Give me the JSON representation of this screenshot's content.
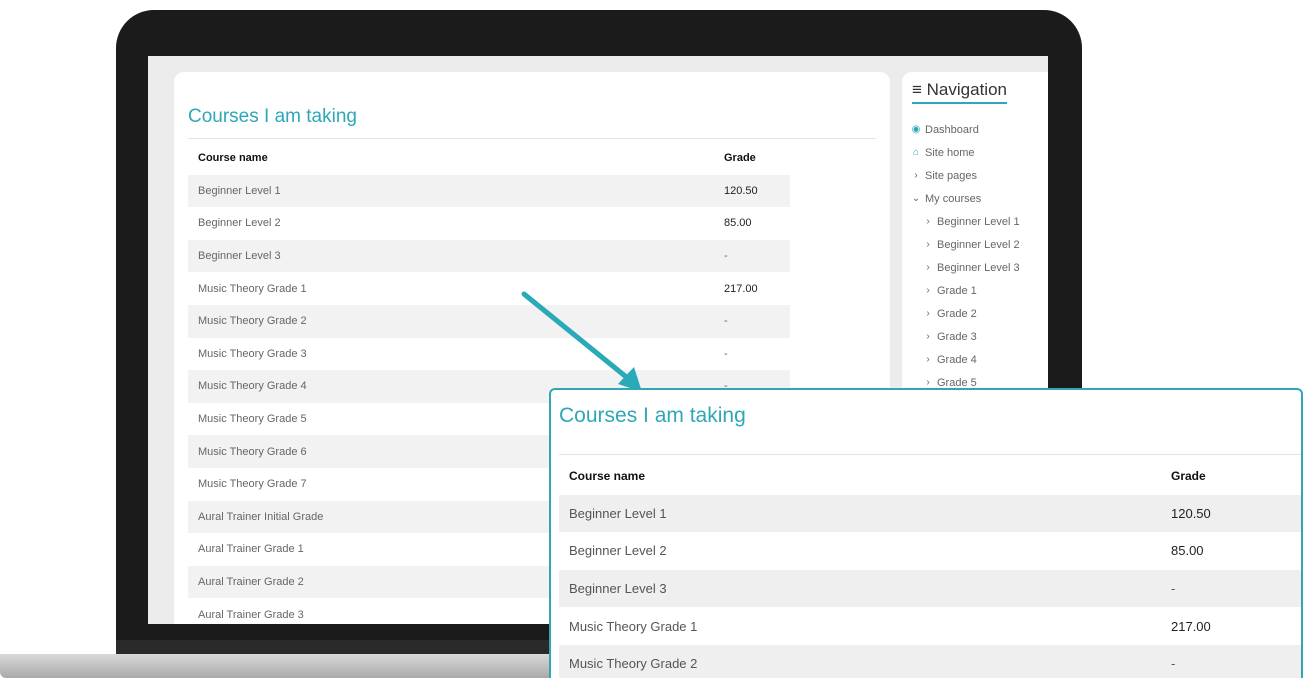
{
  "colors": {
    "accent": "#2ea7b8",
    "row_stripe": "#f2f2f2"
  },
  "main": {
    "title": "Courses I am taking",
    "table": {
      "headers": {
        "name": "Course name",
        "grade": "Grade"
      },
      "rows": [
        {
          "name": "Beginner Level 1",
          "grade": "120.50"
        },
        {
          "name": "Beginner Level 2",
          "grade": "85.00"
        },
        {
          "name": "Beginner Level 3",
          "grade": "-"
        },
        {
          "name": "Music Theory Grade 1",
          "grade": "217.00"
        },
        {
          "name": "Music Theory Grade 2",
          "grade": "-"
        },
        {
          "name": "Music Theory Grade 3",
          "grade": "-"
        },
        {
          "name": "Music Theory Grade 4",
          "grade": "-"
        },
        {
          "name": "Music Theory Grade 5",
          "grade": ""
        },
        {
          "name": "Music Theory Grade 6",
          "grade": ""
        },
        {
          "name": "Music Theory Grade 7",
          "grade": ""
        },
        {
          "name": "Aural Trainer Initial Grade",
          "grade": ""
        },
        {
          "name": "Aural Trainer Grade 1",
          "grade": ""
        },
        {
          "name": "Aural Trainer Grade 2",
          "grade": ""
        },
        {
          "name": "Aural Trainer Grade 3",
          "grade": ""
        }
      ]
    }
  },
  "navigation": {
    "title": "Navigation",
    "items": [
      {
        "icon": "dashboard-icon",
        "glyph": "◉",
        "label": "Dashboard",
        "level": 0
      },
      {
        "icon": "home-icon",
        "glyph": "⌂",
        "label": "Site home",
        "level": 0
      },
      {
        "icon": "chevron-right-icon",
        "glyph": "›",
        "label": "Site pages",
        "level": 0
      },
      {
        "icon": "chevron-down-icon",
        "glyph": "⌄",
        "label": "My courses",
        "level": 0
      },
      {
        "icon": "chevron-right-icon",
        "glyph": "›",
        "label": "Beginner Level 1",
        "level": 1
      },
      {
        "icon": "chevron-right-icon",
        "glyph": "›",
        "label": "Beginner Level 2",
        "level": 1
      },
      {
        "icon": "chevron-right-icon",
        "glyph": "›",
        "label": "Beginner Level 3",
        "level": 1
      },
      {
        "icon": "chevron-right-icon",
        "glyph": "›",
        "label": "Grade 1",
        "level": 1
      },
      {
        "icon": "chevron-right-icon",
        "glyph": "›",
        "label": "Grade 2",
        "level": 1
      },
      {
        "icon": "chevron-right-icon",
        "glyph": "›",
        "label": "Grade 3",
        "level": 1
      },
      {
        "icon": "chevron-right-icon",
        "glyph": "›",
        "label": "Grade 4",
        "level": 1
      },
      {
        "icon": "chevron-right-icon",
        "glyph": "›",
        "label": "Grade 5",
        "level": 1
      }
    ]
  },
  "zoom": {
    "title": "Courses I am taking",
    "table": {
      "headers": {
        "name": "Course name",
        "grade": "Grade"
      },
      "rows": [
        {
          "name": "Beginner Level 1",
          "grade": "120.50"
        },
        {
          "name": "Beginner Level 2",
          "grade": "85.00"
        },
        {
          "name": "Beginner Level 3",
          "grade": "-"
        },
        {
          "name": "Music Theory Grade 1",
          "grade": "217.00"
        },
        {
          "name": "Music Theory Grade 2",
          "grade": "-"
        }
      ]
    }
  }
}
